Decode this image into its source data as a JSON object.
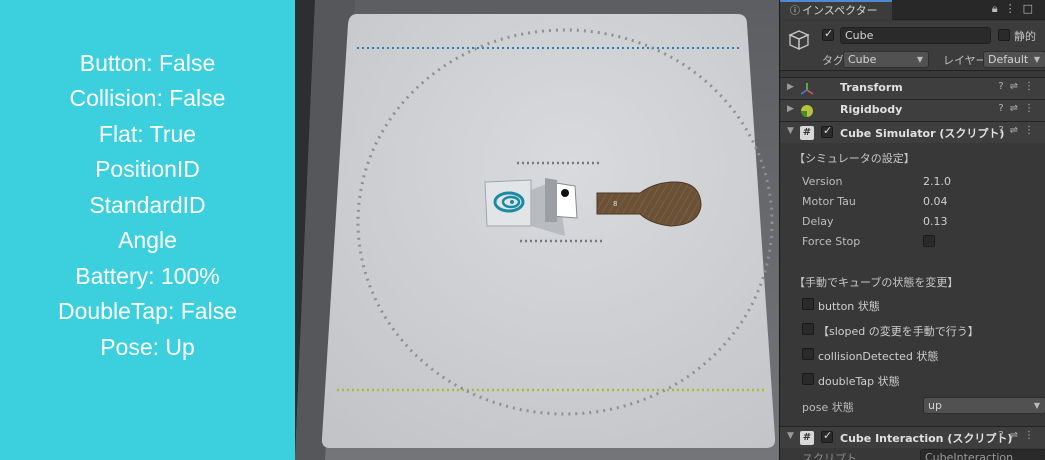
{
  "status_panel": {
    "lines": [
      "Button: False",
      "Collision: False",
      "Flat: True",
      "PositionID",
      "StandardID",
      "Angle",
      "Battery: 100%",
      "DoubleTap: False",
      "Pose: Up"
    ]
  },
  "inspector": {
    "tab_label": "インスペクター",
    "object_name": "Cube",
    "static_label": "静的",
    "tag_label": "タグ",
    "tag_value": "Cube",
    "layer_label": "レイヤー",
    "layer_value": "Default",
    "components": [
      {
        "title": "Transform"
      },
      {
        "title": "Rigidbody"
      },
      {
        "title": "Cube Simulator (スクリプト)"
      },
      {
        "title": "Cube Interaction (スクリプト)"
      }
    ],
    "simulator": {
      "settings_title": "【シミュレータの設定】",
      "props": [
        {
          "label": "Version",
          "value": "2.1.0"
        },
        {
          "label": "Motor Tau",
          "value": "0.04"
        },
        {
          "label": "Delay",
          "value": "0.13"
        },
        {
          "label": "Force Stop",
          "value": ""
        }
      ],
      "manual_title": "【手動でキューブの状態を変更】",
      "toggles": [
        "button 状態",
        "【sloped の変更を手動で行う】",
        "collisionDetected 状態",
        "doubleTap 状態"
      ],
      "pose_label": "pose 状態",
      "pose_value": "up"
    },
    "interaction": {
      "script_label": "スクリプト",
      "script_value": "CubeInteraction"
    }
  },
  "colors": {
    "status_bg": "#3cd0de",
    "inspector_bg": "#383838",
    "mat_dots_blue": "#2a7fb5",
    "mat_dots_green": "#9cc13a"
  }
}
